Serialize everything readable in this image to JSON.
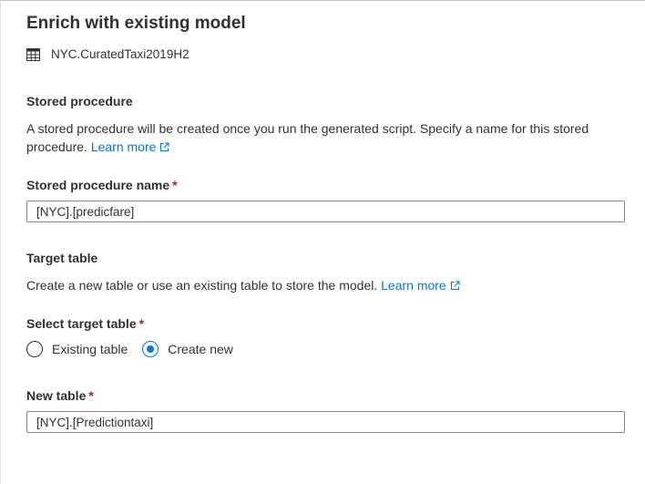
{
  "panel": {
    "title": "Enrich with existing model",
    "dataset_name": "NYC.CuratedTaxi2019H2",
    "dataset_icon": "table-icon"
  },
  "stored_procedure": {
    "heading": "Stored procedure",
    "description": "A stored procedure will be created once you run the generated script. Specify a name for this stored procedure.",
    "learn_more": "Learn more",
    "name_label": "Stored procedure name",
    "required_marker": "*",
    "name_value": "[NYC].[predicfare]"
  },
  "target_table": {
    "heading": "Target table",
    "description": "Create a new table or use an existing table to store the model.",
    "learn_more": "Learn more",
    "select_label": "Select target table",
    "required_marker": "*",
    "options": [
      {
        "label": "Existing table",
        "selected": false
      },
      {
        "label": "Create new",
        "selected": true
      }
    ],
    "new_table_label": "New table",
    "new_table_required_marker": "*",
    "new_table_value": "[NYC].[Predictiontaxi]"
  },
  "colors": {
    "accent": "#0078d4",
    "required": "#a4262c",
    "text": "#323130",
    "border": "#8a8886"
  }
}
